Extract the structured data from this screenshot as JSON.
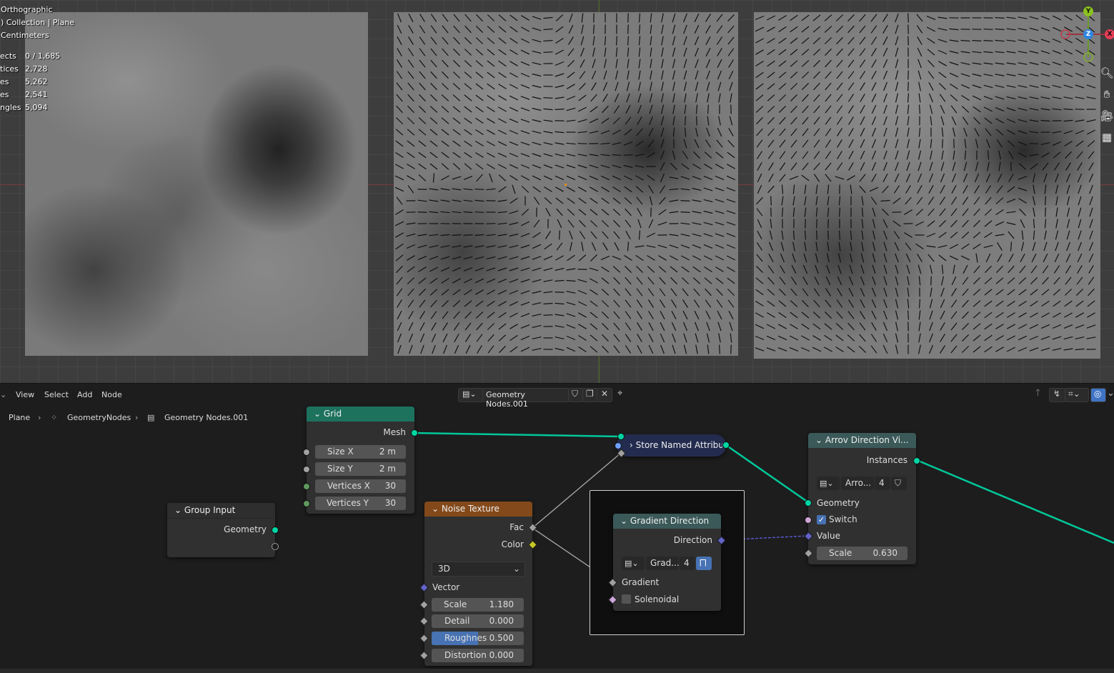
{
  "viewport": {
    "view_mode": "Orthographic",
    "collection_path": ") Collection | Plane",
    "units": "Centimeters",
    "stats": [
      {
        "label": "ects",
        "value": "0 / 1,685"
      },
      {
        "label": "tices",
        "value": "2,728"
      },
      {
        "label": "es",
        "value": "5,262"
      },
      {
        "label": "es",
        "value": "2,541"
      },
      {
        "label": "ngles",
        "value": "5,094"
      }
    ],
    "gizmo": {
      "y": "Y",
      "z": "Z",
      "x": "X"
    },
    "nav_icons": [
      "zoom-icon",
      "pan-hand-icon",
      "camera-icon",
      "grid-view-icon"
    ]
  },
  "node_editor": {
    "menus": [
      "View",
      "Select",
      "Add",
      "Node"
    ],
    "node_tree_name": "Geometry Nodes.001",
    "breadcrumb": [
      "Plane",
      "GeometryNodes",
      "Geometry Nodes.001"
    ]
  },
  "nodes": {
    "grid": {
      "title": "Grid",
      "output": "Mesh",
      "fields": [
        {
          "label": "Size X",
          "value": "2 m"
        },
        {
          "label": "Size Y",
          "value": "2 m"
        },
        {
          "label": "Vertices X",
          "value": "30"
        },
        {
          "label": "Vertices Y",
          "value": "30"
        }
      ]
    },
    "group_input": {
      "title": "Group Input",
      "output": "Geometry"
    },
    "noise": {
      "title": "Noise Texture",
      "outputs": [
        "Fac",
        "Color"
      ],
      "dimensions": "3D",
      "vector": "Vector",
      "fields": [
        {
          "label": "Scale",
          "value": "1.180"
        },
        {
          "label": "Detail",
          "value": "0.000"
        },
        {
          "label": "Roughnes",
          "value": "0.500"
        },
        {
          "label": "Distortion",
          "value": "0.000"
        }
      ],
      "roughness_fraction": 0.5
    },
    "store": {
      "title": "Store Named Attribut"
    },
    "gradient": {
      "title": "Gradient Direction",
      "output": "Direction",
      "group_name": "Grad...",
      "users": "4",
      "inputs": [
        "Gradient",
        "Solenoidal"
      ]
    },
    "arrow": {
      "title": "Arrov Direction Vi...",
      "output": "Instances",
      "group_name": "Arro...",
      "users": "4",
      "inputs": [
        "Geometry",
        "Switch",
        "Value"
      ],
      "switch_checked": true,
      "scale": {
        "label": "Scale",
        "value": "0.630"
      }
    }
  },
  "colors": {
    "geometry_socket": "#00d6a3",
    "float_socket": "#a1a1a1",
    "vector_socket": "#6363c7",
    "color_socket": "#c7c729",
    "bool_socket": "#cca6d6",
    "grid_header": "#1d725e",
    "noise_header": "#83491a",
    "group_header": "#3b5959",
    "store_header": "#2f3b64"
  }
}
